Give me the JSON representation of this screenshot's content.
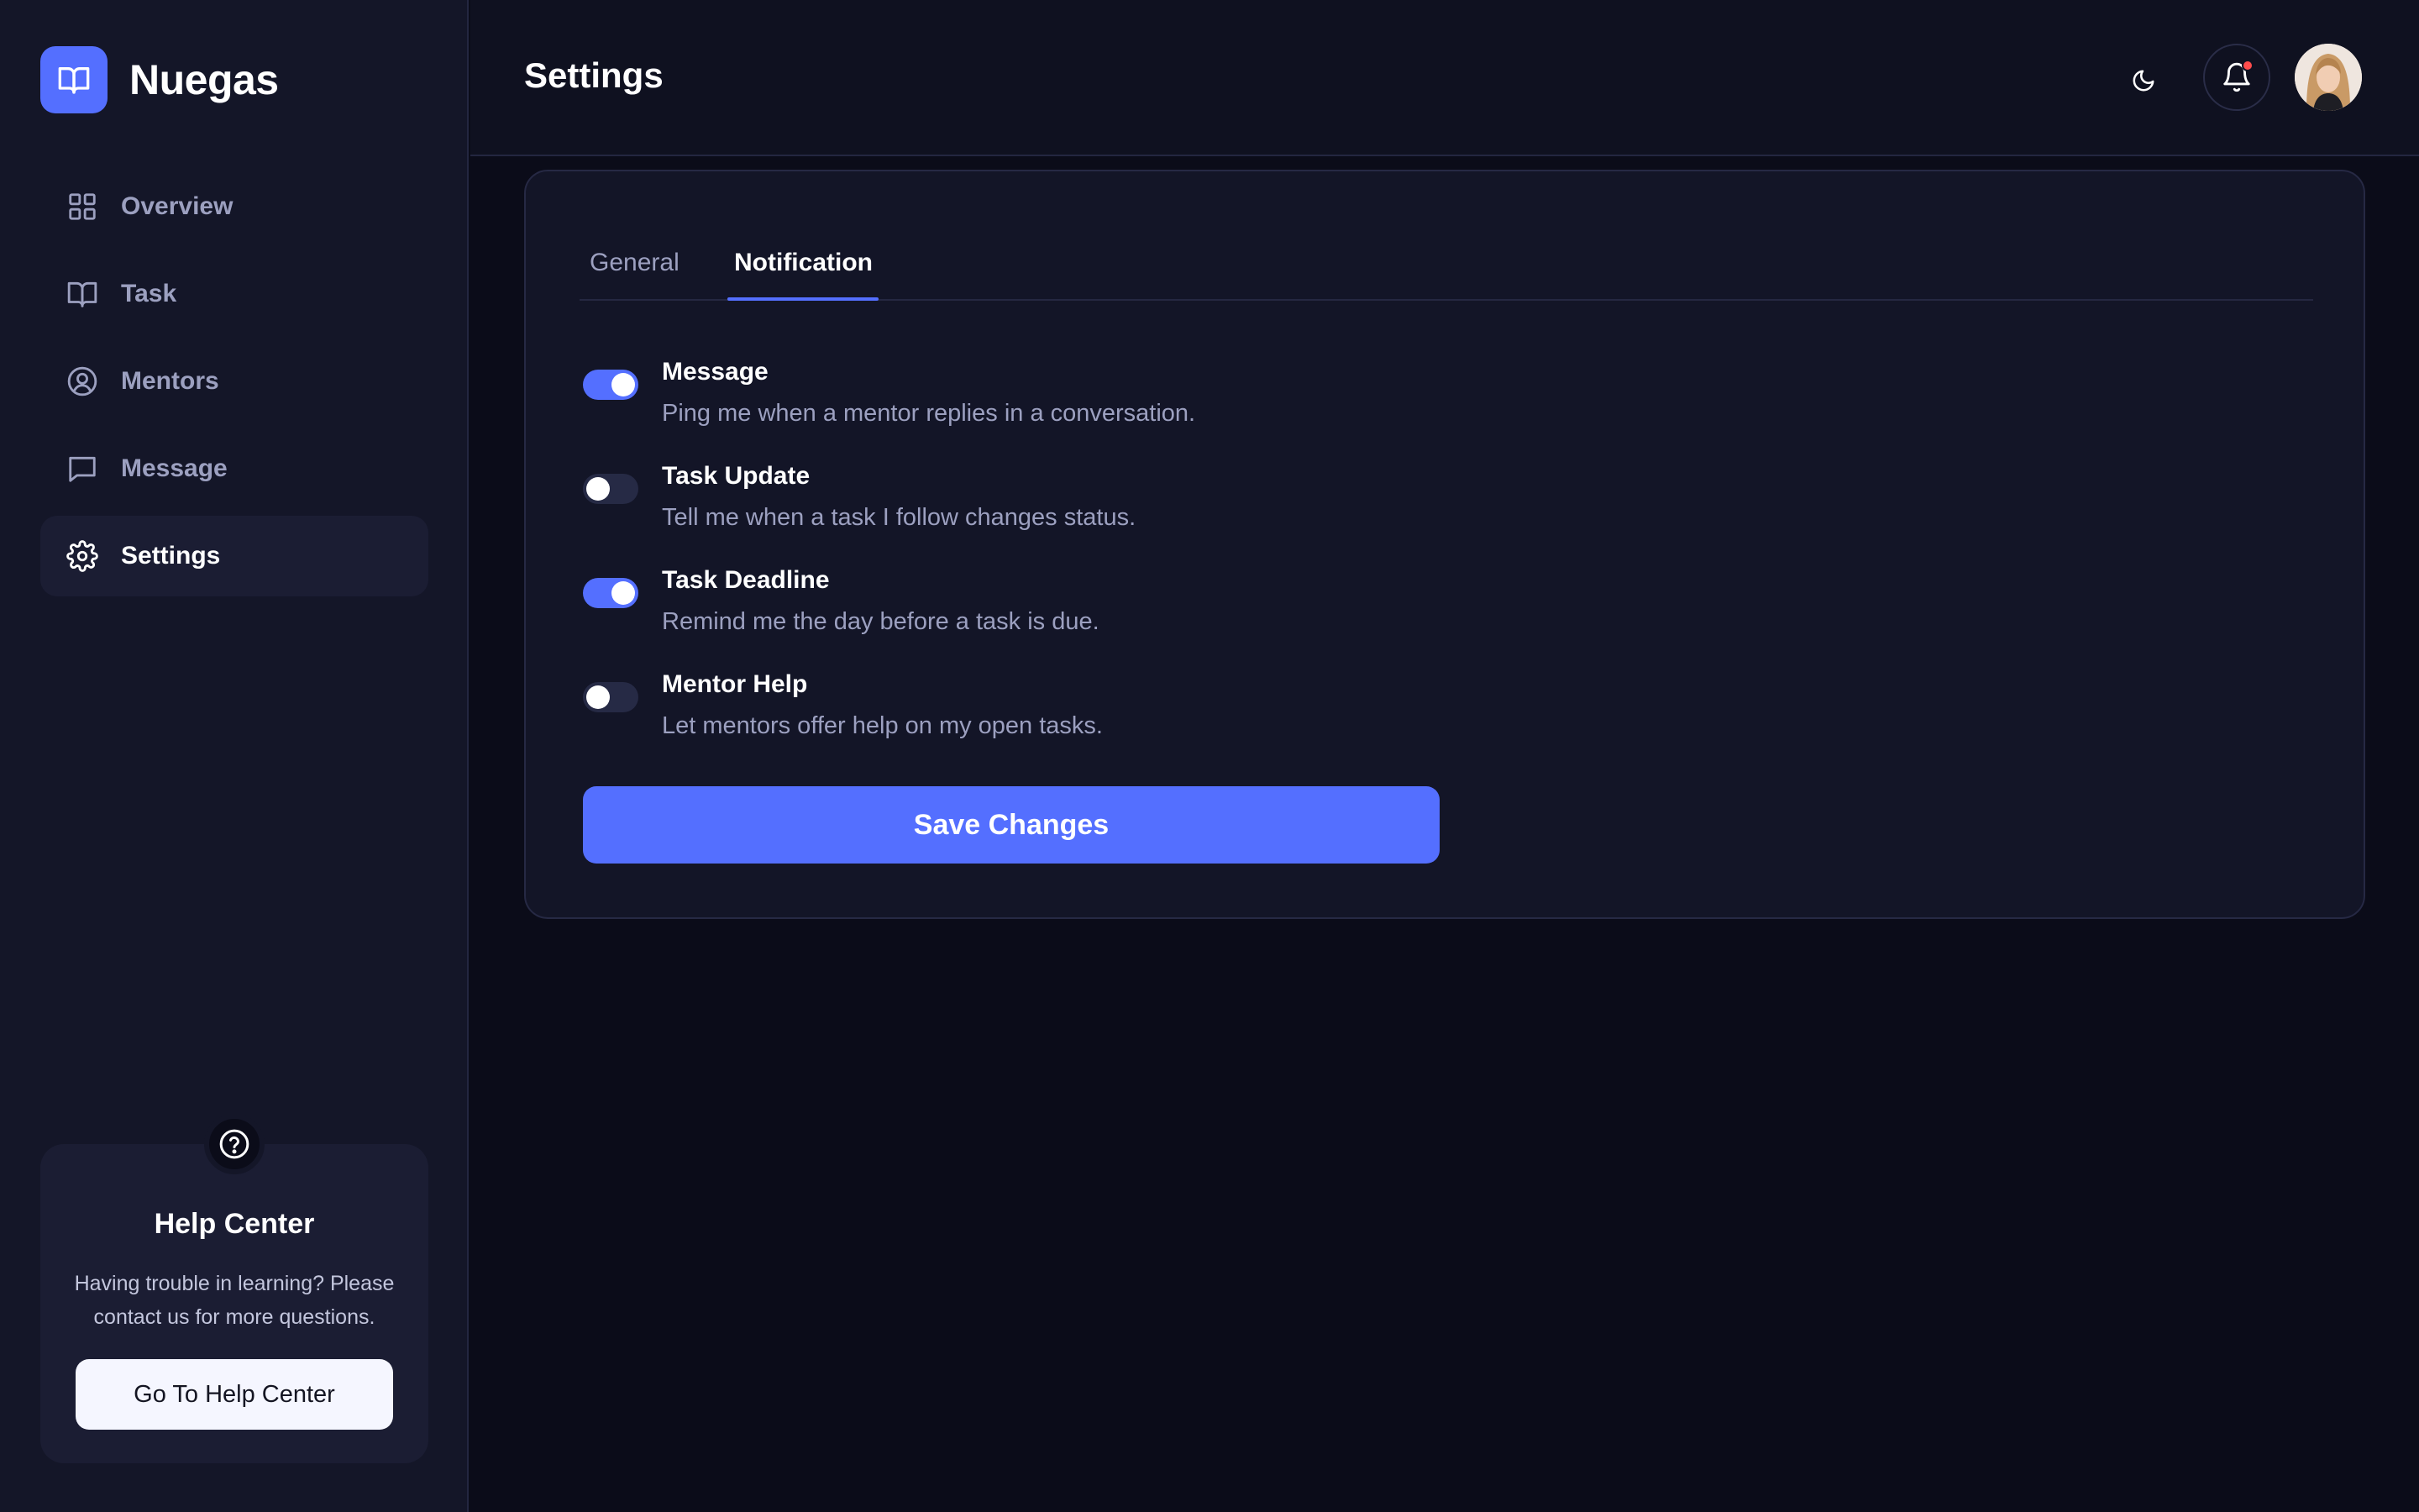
{
  "brand": {
    "name": "Nuegas"
  },
  "sidebar": {
    "items": [
      {
        "label": "Overview",
        "icon": "grid-icon",
        "active": false
      },
      {
        "label": "Task",
        "icon": "book-icon",
        "active": false
      },
      {
        "label": "Mentors",
        "icon": "user-circle-icon",
        "active": false
      },
      {
        "label": "Message",
        "icon": "chat-icon",
        "active": false
      },
      {
        "label": "Settings",
        "icon": "gear-icon",
        "active": true
      }
    ],
    "help": {
      "title": "Help Center",
      "text": "Having trouble in learning? Please contact us for more questions.",
      "button_label": "Go To Help Center"
    }
  },
  "header": {
    "title": "Settings",
    "has_notification": true
  },
  "tabs": [
    {
      "label": "General",
      "active": false
    },
    {
      "label": "Notification",
      "active": true
    }
  ],
  "notifications": [
    {
      "title": "Message",
      "description": "Ping me when a mentor replies in a conversation.",
      "enabled": true
    },
    {
      "title": "Task Update",
      "description": "Tell me when a task I follow changes status.",
      "enabled": false
    },
    {
      "title": "Task Deadline",
      "description": "Remind me the day before a task is due.",
      "enabled": true
    },
    {
      "title": "Mentor Help",
      "description": "Let mentors offer help on my open tasks.",
      "enabled": false
    }
  ],
  "actions": {
    "save_label": "Save Changes"
  },
  "colors": {
    "accent": "#546fff",
    "background": "#0b0c19",
    "sidebar": "#141628",
    "card": "#131527",
    "muted_text": "#9ca0c0",
    "notification_dot": "#ff4c4c"
  }
}
